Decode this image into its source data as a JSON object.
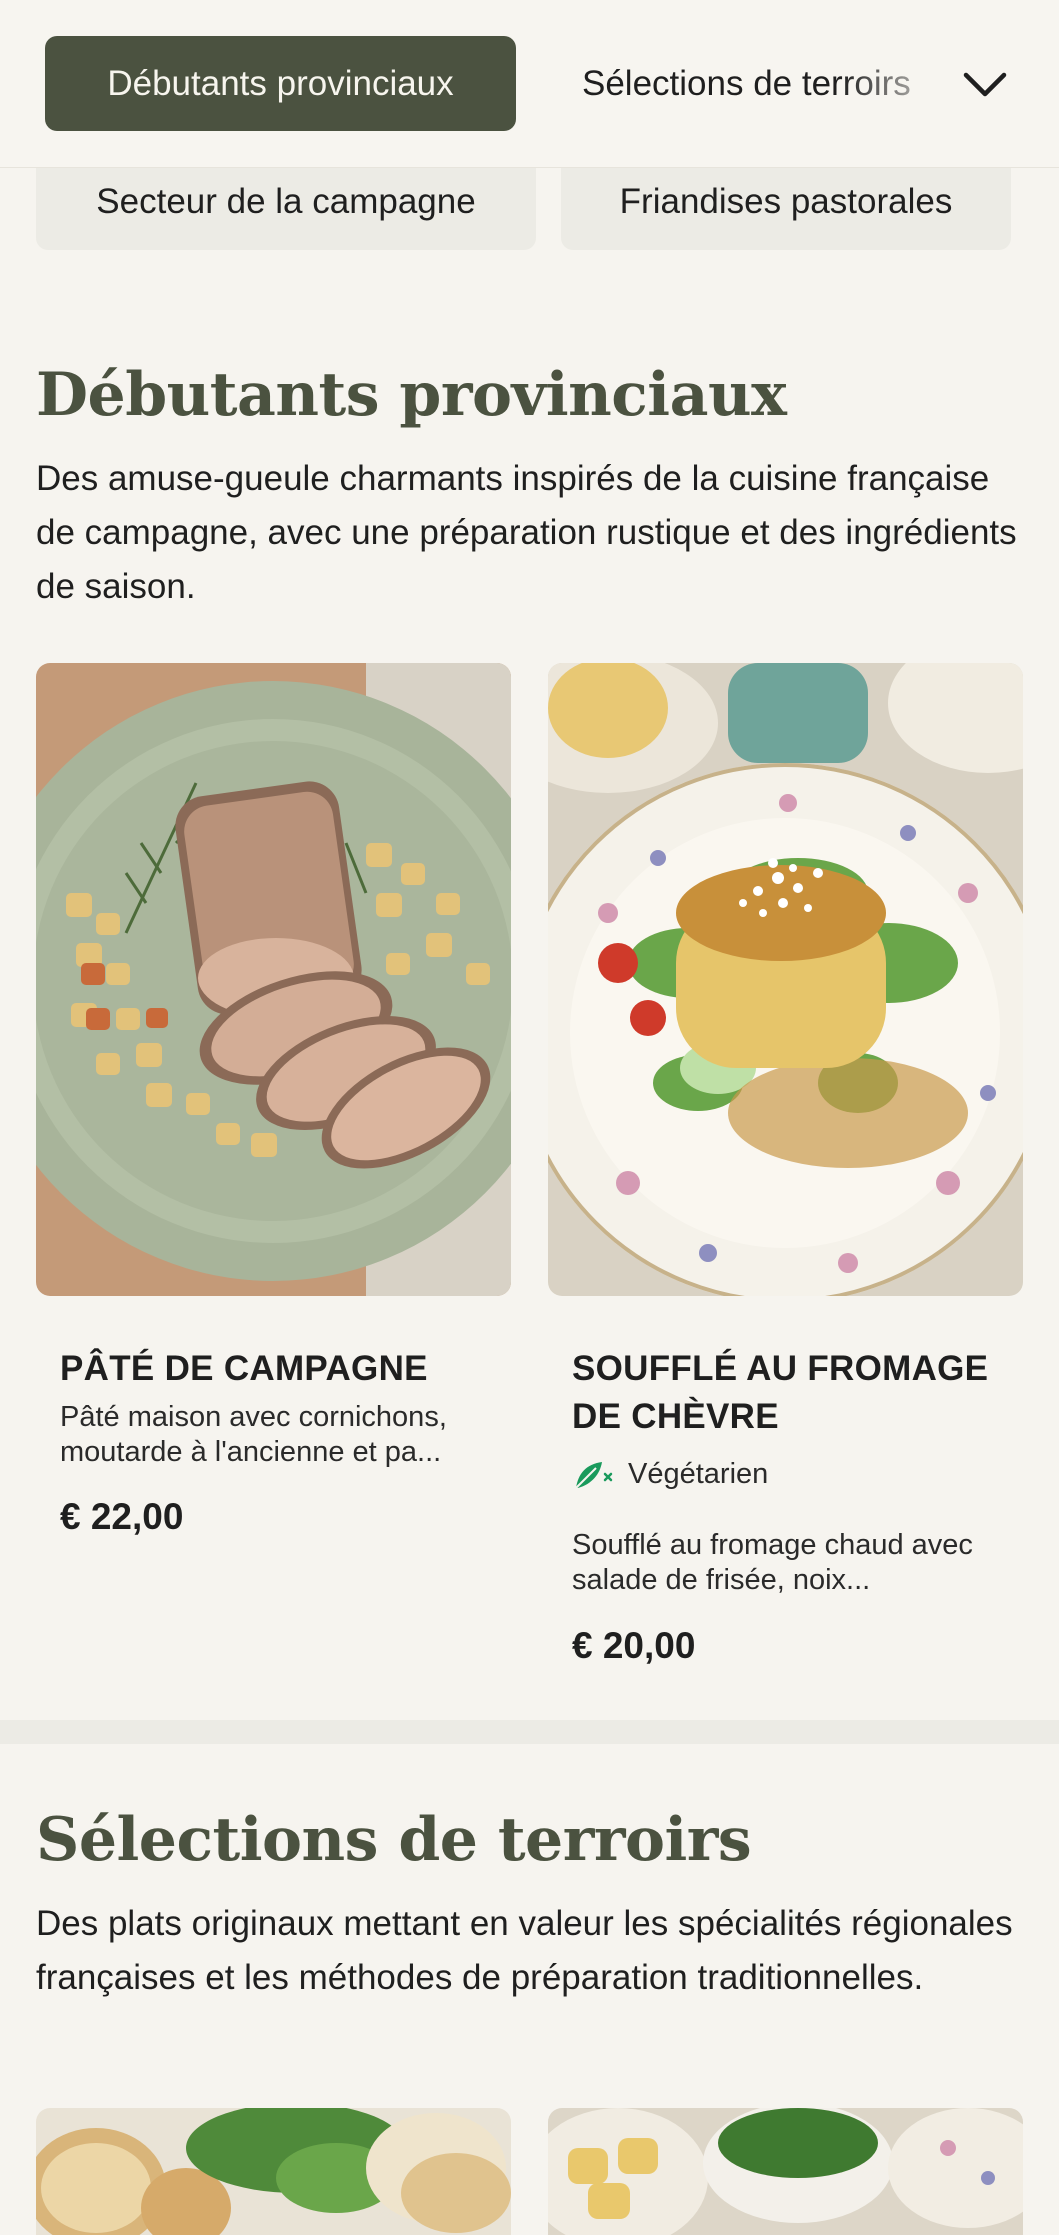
{
  "nav": {
    "active_tab": "Débutants provinciaux",
    "next_tab": "Sélections de terroirs",
    "row2": [
      "Secteur de la campagne",
      "Friandises pastorales"
    ]
  },
  "sections": [
    {
      "title": "Débutants provinciaux",
      "description": "Des amuse-gueule charmants inspirés de la cuisine française de campagne, avec une préparation rustique et des ingrédients de saison.",
      "items": [
        {
          "name": "PÂTÉ DE CAMPAGNE",
          "description": "Pâté maison avec cornichons, moutarde à l'ancienne et pa...",
          "price": "€ 22,00"
        },
        {
          "name": "SOUFFLÉ AU FROMAGE DE CHÈVRE",
          "badge": "Végétarien",
          "description": "Soufflé au fromage chaud avec salade de frisée, noix...",
          "price": "€ 20,00"
        }
      ]
    },
    {
      "title": "Sélections de terroirs",
      "description": "Des plats originaux mettant en valeur les spécialités régionales françaises et les méthodes de préparation traditionnelles."
    }
  ],
  "colors": {
    "accent": "#4b5240",
    "background": "#f6f4ef",
    "veg_icon": "#1a9a5c"
  },
  "icons": {
    "dropdown": "chevron-down-icon",
    "vegetarian": "leaf-icon"
  }
}
